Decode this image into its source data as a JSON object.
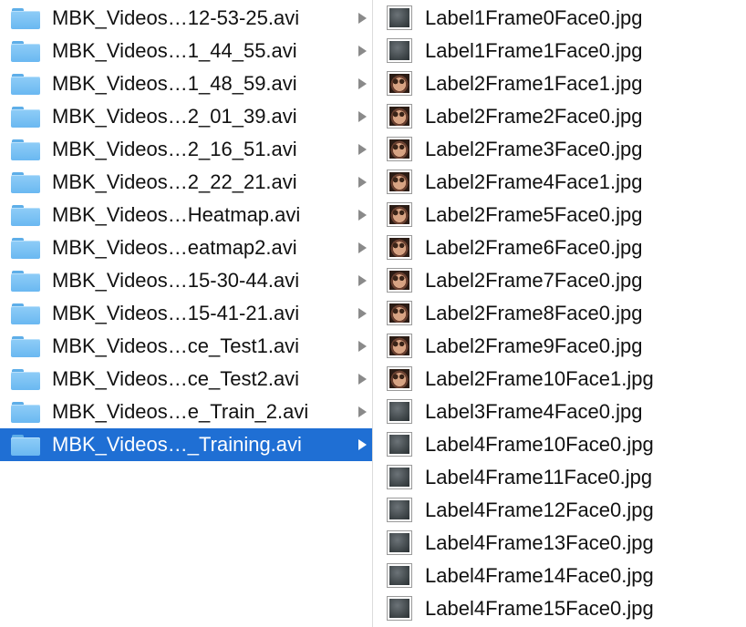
{
  "folders": [
    {
      "name": "MBK_Videos…12-53-25.avi",
      "selected": false
    },
    {
      "name": "MBK_Videos…1_44_55.avi",
      "selected": false
    },
    {
      "name": "MBK_Videos…1_48_59.avi",
      "selected": false
    },
    {
      "name": "MBK_Videos…2_01_39.avi",
      "selected": false
    },
    {
      "name": "MBK_Videos…2_16_51.avi",
      "selected": false
    },
    {
      "name": "MBK_Videos…2_22_21.avi",
      "selected": false
    },
    {
      "name": "MBK_Videos…Heatmap.avi",
      "selected": false
    },
    {
      "name": "MBK_Videos…eatmap2.avi",
      "selected": false
    },
    {
      "name": "MBK_Videos…15-30-44.avi",
      "selected": false
    },
    {
      "name": "MBK_Videos…15-41-21.avi",
      "selected": false
    },
    {
      "name": "MBK_Videos…ce_Test1.avi",
      "selected": false
    },
    {
      "name": "MBK_Videos…ce_Test2.avi",
      "selected": false
    },
    {
      "name": "MBK_Videos…e_Train_2.avi",
      "selected": false
    },
    {
      "name": "MBK_Videos…_Training.avi",
      "selected": true
    }
  ],
  "files": [
    {
      "name": "Label1Frame0Face0.jpg",
      "thumb": "dark"
    },
    {
      "name": "Label1Frame1Face0.jpg",
      "thumb": "dark"
    },
    {
      "name": "Label2Frame1Face1.jpg",
      "thumb": "face"
    },
    {
      "name": "Label2Frame2Face0.jpg",
      "thumb": "face"
    },
    {
      "name": "Label2Frame3Face0.jpg",
      "thumb": "face"
    },
    {
      "name": "Label2Frame4Face1.jpg",
      "thumb": "face"
    },
    {
      "name": "Label2Frame5Face0.jpg",
      "thumb": "face"
    },
    {
      "name": "Label2Frame6Face0.jpg",
      "thumb": "face"
    },
    {
      "name": "Label2Frame7Face0.jpg",
      "thumb": "face"
    },
    {
      "name": "Label2Frame8Face0.jpg",
      "thumb": "face"
    },
    {
      "name": "Label2Frame9Face0.jpg",
      "thumb": "face"
    },
    {
      "name": "Label2Frame10Face1.jpg",
      "thumb": "face"
    },
    {
      "name": "Label3Frame4Face0.jpg",
      "thumb": "dark"
    },
    {
      "name": "Label4Frame10Face0.jpg",
      "thumb": "dark"
    },
    {
      "name": "Label4Frame11Face0.jpg",
      "thumb": "dark"
    },
    {
      "name": "Label4Frame12Face0.jpg",
      "thumb": "dark"
    },
    {
      "name": "Label4Frame13Face0.jpg",
      "thumb": "dark"
    },
    {
      "name": "Label4Frame14Face0.jpg",
      "thumb": "dark"
    },
    {
      "name": "Label4Frame15Face0.jpg",
      "thumb": "dark"
    }
  ],
  "icons": {
    "folder": "folder-icon",
    "disclosure": "chevron-right-icon",
    "thumbnail": "image-thumbnail-icon"
  },
  "colors": {
    "selection": "#1f6fd4",
    "folder": "#6ab8f1"
  }
}
